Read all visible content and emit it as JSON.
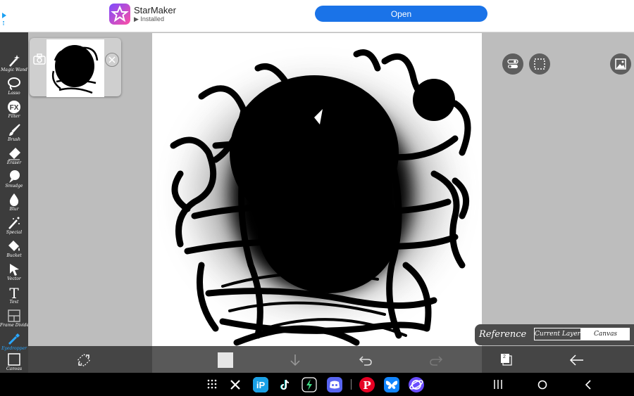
{
  "ad": {
    "app_name": "StarMaker",
    "status": "Installed",
    "open_label": "Open",
    "icon": "starmaker-logo-icon"
  },
  "sidebar": {
    "tools": [
      {
        "label": "Magic Wand",
        "icon": "magic-wand-icon"
      },
      {
        "label": "Lasso",
        "icon": "lasso-icon"
      },
      {
        "label": "Filter",
        "icon": "fx-filter-icon",
        "glyph": "FX"
      },
      {
        "label": "Brush",
        "icon": "brush-icon"
      },
      {
        "label": "Eraser",
        "icon": "eraser-icon"
      },
      {
        "label": "Smudge",
        "icon": "smudge-icon"
      },
      {
        "label": "Blur",
        "icon": "blur-drop-icon"
      },
      {
        "label": "Special",
        "icon": "special-wand-icon"
      },
      {
        "label": "Bucket",
        "icon": "bucket-icon"
      },
      {
        "label": "Vector",
        "icon": "vector-arrow-icon"
      },
      {
        "label": "Text",
        "icon": "text-icon",
        "glyph": "T"
      },
      {
        "label": "Frame Divider",
        "icon": "frame-divider-icon"
      },
      {
        "label": "Eyedropper",
        "icon": "eyedropper-icon",
        "active": true
      },
      {
        "label": "Canvas",
        "icon": "canvas-icon"
      }
    ]
  },
  "reference": {
    "label": "Reference",
    "current_layer": "Current Layer",
    "canvas": "Canvas",
    "selected": "Canvas"
  },
  "top_right": [
    "adjust-toggle-icon",
    "selection-marquee-icon",
    "reference-image-icon"
  ],
  "bottom_toolbar": [
    "transform-icon",
    "color-swatch",
    "layer-down-icon",
    "undo-icon",
    "redo-icon",
    "layers-icon",
    "back-arrow-icon"
  ],
  "layers_count": "2",
  "colors": {
    "sidebar": "#3c3c3c",
    "active_tool": "#2aa6ff",
    "canvas_bg": "#ffffff",
    "workspace": "#bdbdbd",
    "ad_button": "#1a73e8"
  },
  "system_nav": {
    "apps": [
      "app-drawer-icon",
      "x-icon",
      "ibis-paint-icon",
      "tiktok-icon",
      "flash-app-icon",
      "discord-icon",
      "pinterest-icon",
      "bluesky-icon",
      "samsung-internet-icon"
    ],
    "buttons": [
      "recents-icon",
      "home-icon",
      "back-icon"
    ]
  }
}
